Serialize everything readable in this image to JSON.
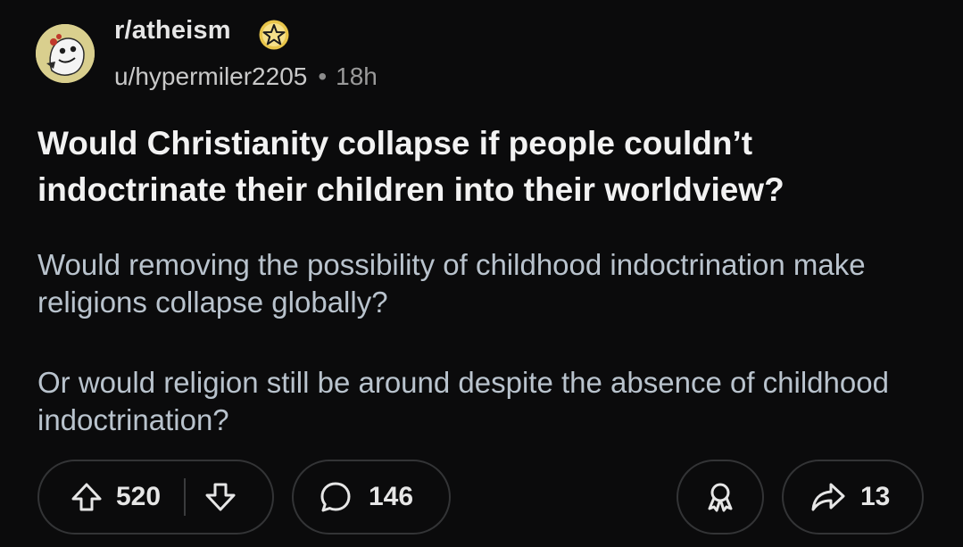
{
  "post": {
    "subreddit": "r/atheism",
    "author": "u/hypermiler2205",
    "separator": "•",
    "age": "18h",
    "title": "Would Christianity collapse if people couldn’t indoctrinate their children into their worldview?",
    "body": [
      "Would removing the possibility of childhood indoctrination make religions collapse globally?",
      "Or would religion still be around despite the absence of childhood indoctrination?"
    ]
  },
  "actions": {
    "votes": "520",
    "comments": "146",
    "shares": "13"
  },
  "icons": {
    "avatar": "subreddit-avatar",
    "award": "star-award-icon",
    "upvote": "upvote-arrow-icon",
    "downvote": "downvote-arrow-icon",
    "comment": "speech-bubble-icon",
    "give_award": "award-ribbon-icon",
    "share": "share-arrow-icon"
  },
  "colors": {
    "background": "#0b0b0c",
    "title": "#f2f2f2",
    "body": "#b9c3cd",
    "pill_border": "#333436",
    "award_gold": "#e8c54a"
  }
}
